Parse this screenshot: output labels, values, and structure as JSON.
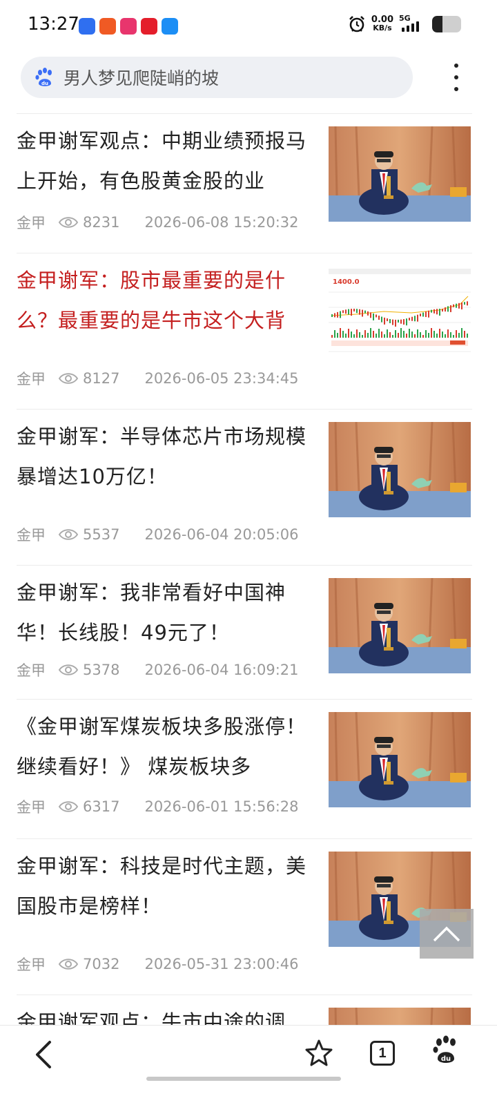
{
  "status_bar": {
    "time": "13:27",
    "net_speed": "0.00",
    "net_unit": "KB/s",
    "network_type": "5G",
    "signal_bars": 4,
    "battery_level": 0.35,
    "app_icons": [
      {
        "name": "baidu-app-icon",
        "color": "#2f6ff0"
      },
      {
        "name": "orange-app-icon",
        "color": "#f05a24"
      },
      {
        "name": "pink-app-icon",
        "color": "#e8356d"
      },
      {
        "name": "red-app-icon",
        "color": "#e41e2b"
      },
      {
        "name": "blue-app-icon",
        "color": "#1c8ef5"
      }
    ]
  },
  "search": {
    "query": "男人梦见爬陡峭的坡",
    "logo_icon": "baidu-paw-icon"
  },
  "articles": [
    {
      "title": "金甲谢军观点：中期业绩预报马上开始，有色股黄金股的业",
      "author": "金甲",
      "views": "8231",
      "date": "2026-06-08 15:20:32",
      "thumb": "video",
      "highlight": false
    },
    {
      "title": "金甲谢军：股市最重要的是什么？最重要的是牛市这个大背",
      "author": "金甲",
      "views": "8127",
      "date": "2026-06-05 23:34:45",
      "thumb": "chart",
      "highlight": true
    },
    {
      "title": "金甲谢军：半导体芯片市场规模暴增达10万亿！",
      "author": "金甲",
      "views": "5537",
      "date": "2026-06-04 20:05:06",
      "thumb": "video",
      "highlight": false
    },
    {
      "title": "金甲谢军：我非常看好中国神华！长线股！49元了！",
      "author": "金甲",
      "views": "5378",
      "date": "2026-06-04 16:09:21",
      "thumb": "video",
      "highlight": false
    },
    {
      "title": "《金甲谢军煤炭板块多股涨停！继续看好！》 煤炭板块多",
      "author": "金甲",
      "views": "6317",
      "date": "2026-06-01 15:56:28",
      "thumb": "video",
      "highlight": false
    },
    {
      "title": "金甲谢军：科技是时代主题，美国股市是榜样！",
      "author": "金甲",
      "views": "7032",
      "date": "2026-05-31 23:00:46",
      "thumb": "video",
      "highlight": false
    },
    {
      "title": "金甲谢军观点：牛市中途的调",
      "author": "",
      "views": "",
      "date": "",
      "thumb": "video",
      "highlight": false
    }
  ],
  "chart_thumb": {
    "big_number": "1400.0"
  },
  "bottom_nav": {
    "tab_count": "1",
    "icons": [
      "back-arrow-icon",
      "star-icon",
      "tabs-icon",
      "baidu-paw-icon"
    ]
  },
  "colors": {
    "highlight_title": "#c41f1f",
    "meta_text": "#999999",
    "search_bg": "#eef0f4"
  }
}
